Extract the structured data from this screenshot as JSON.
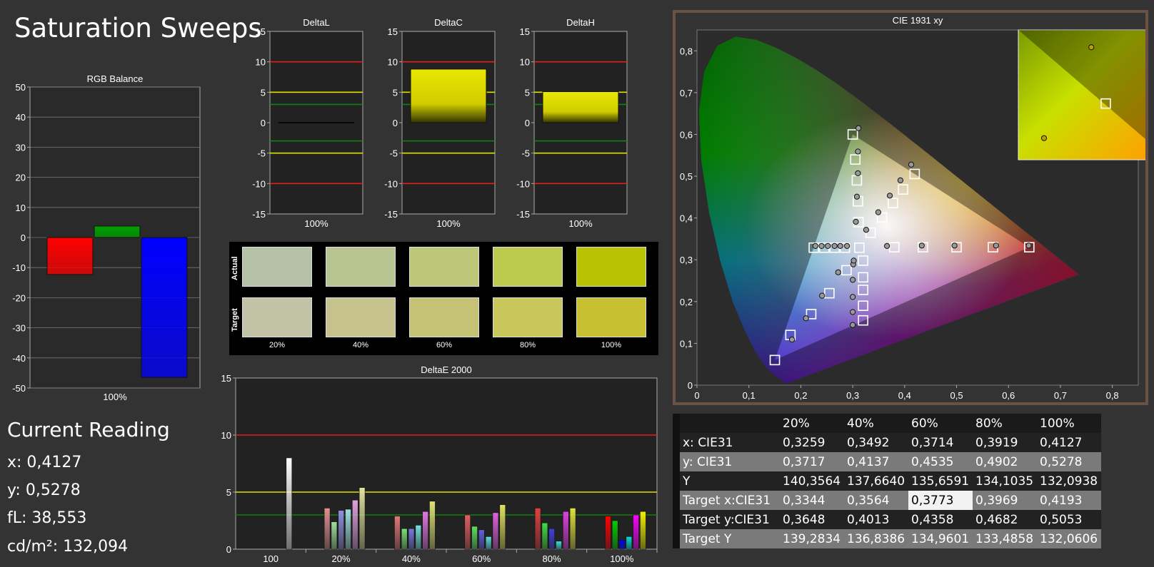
{
  "page_title": "Saturation Sweeps",
  "current_reading": {
    "title": "Current Reading",
    "x": "x: 0,4127",
    "y": "y: 0,5278",
    "fL": "fL: 38,553",
    "cdm2": "cd/m²: 132,094"
  },
  "swatches": {
    "row_labels": {
      "actual": "Actual",
      "target": "Target"
    },
    "labels": [
      "20%",
      "40%",
      "60%",
      "80%",
      "100%"
    ],
    "actual_colors": [
      "#b6c2a7",
      "#b9c590",
      "#bcc777",
      "#bccb4e",
      "#b9c304"
    ],
    "target_colors": [
      "#c2c2a6",
      "#c5c28e",
      "#c5c276",
      "#c7c75c",
      "#c6c030"
    ]
  },
  "table": {
    "headers": [
      "20%",
      "40%",
      "60%",
      "80%",
      "100%"
    ],
    "rows": [
      {
        "label": "x: CIE31",
        "values": [
          "0,3259",
          "0,3492",
          "0,3714",
          "0,3919",
          "0,4127"
        ]
      },
      {
        "label": "y: CIE31",
        "values": [
          "0,3717",
          "0,4137",
          "0,4535",
          "0,4902",
          "0,5278"
        ]
      },
      {
        "label": "Y",
        "values": [
          "140,3564",
          "137,6640",
          "135,6591",
          "134,1035",
          "132,0938"
        ]
      },
      {
        "label": "Target x:CIE31",
        "values": [
          "0,3344",
          "0,3564",
          "0,3773",
          "0,3969",
          "0,4193"
        ]
      },
      {
        "label": "Target y:CIE31",
        "values": [
          "0,3648",
          "0,4013",
          "0,4358",
          "0,4682",
          "0,5053"
        ]
      },
      {
        "label": "Target Y",
        "values": [
          "139,2834",
          "136,8386",
          "134,9601",
          "133,4858",
          "132,0606"
        ]
      }
    ]
  },
  "chart_data": [
    {
      "type": "bar",
      "title": "RGB Balance",
      "categories": [
        "100%"
      ],
      "series": [
        {
          "name": "Red",
          "color": "#ff0000",
          "values": [
            -12.3
          ]
        },
        {
          "name": "Green",
          "color": "#00a000",
          "values": [
            3.8
          ]
        },
        {
          "name": "Blue",
          "color": "#0000ff",
          "values": [
            -46.5
          ]
        }
      ],
      "ylim": [
        -50,
        50
      ],
      "yticks": [
        "50",
        "40",
        "30",
        "20",
        "10",
        "0",
        "-10",
        "-20",
        "-30",
        "-40",
        "-50"
      ]
    },
    {
      "type": "bar",
      "title": "DeltaL",
      "categories": [
        "100%"
      ],
      "values": [
        -0.1
      ],
      "ylim": [
        -15,
        15
      ],
      "yticks": [
        "15",
        "10",
        "5",
        "0",
        "-5",
        "-10",
        "-15"
      ]
    },
    {
      "type": "bar",
      "title": "DeltaC",
      "categories": [
        "100%"
      ],
      "values": [
        8.8
      ],
      "ylim": [
        -15,
        15
      ],
      "yticks": [
        "15",
        "10",
        "5",
        "0",
        "-5",
        "-10",
        "-15"
      ]
    },
    {
      "type": "bar",
      "title": "DeltaH",
      "categories": [
        "100%"
      ],
      "values": [
        5.1
      ],
      "ylim": [
        -15,
        15
      ],
      "yticks": [
        "15",
        "10",
        "5",
        "0",
        "-5",
        "-10",
        "-15"
      ]
    },
    {
      "type": "bar",
      "title": "DeltaE 2000",
      "categories": [
        "100",
        "20%",
        "40%",
        "60%",
        "80%",
        "100%"
      ],
      "ylim": [
        0,
        15
      ],
      "yticks": [
        "15",
        "10",
        "5",
        "0"
      ],
      "groups": [
        {
          "bars": [
            {
              "value": 8.0,
              "color": "#ffffff"
            }
          ]
        },
        {
          "bars": [
            {
              "value": 3.6,
              "color": "#e09090"
            },
            {
              "value": 2.4,
              "color": "#a0e0a0"
            },
            {
              "value": 3.4,
              "color": "#9090e0"
            },
            {
              "value": 3.5,
              "color": "#a0e0e0"
            },
            {
              "value": 4.3,
              "color": "#e0a0e0"
            },
            {
              "value": 5.4,
              "color": "#e0e0a0"
            }
          ]
        },
        {
          "bars": [
            {
              "value": 2.9,
              "color": "#e07878"
            },
            {
              "value": 1.8,
              "color": "#78e078"
            },
            {
              "value": 1.8,
              "color": "#7878e0"
            },
            {
              "value": 2.1,
              "color": "#78e0e0"
            },
            {
              "value": 3.3,
              "color": "#e078e0"
            },
            {
              "value": 4.2,
              "color": "#e0e078"
            }
          ]
        },
        {
          "bars": [
            {
              "value": 3.0,
              "color": "#e06060"
            },
            {
              "value": 2.0,
              "color": "#60e060"
            },
            {
              "value": 1.7,
              "color": "#6060e0"
            },
            {
              "value": 1.1,
              "color": "#60e0e0"
            },
            {
              "value": 3.2,
              "color": "#e060e0"
            },
            {
              "value": 3.9,
              "color": "#e0e060"
            }
          ]
        },
        {
          "bars": [
            {
              "value": 3.6,
              "color": "#e04040"
            },
            {
              "value": 2.3,
              "color": "#40e040"
            },
            {
              "value": 1.8,
              "color": "#4040e0"
            },
            {
              "value": 0.7,
              "color": "#40e0e0"
            },
            {
              "value": 3.3,
              "color": "#e040e0"
            },
            {
              "value": 3.6,
              "color": "#e0e040"
            }
          ]
        },
        {
          "bars": [
            {
              "value": 2.9,
              "color": "#ff0000"
            },
            {
              "value": 2.5,
              "color": "#00d000"
            },
            {
              "value": 0.8,
              "color": "#0000ff"
            },
            {
              "value": 1.1,
              "color": "#00e0e0"
            },
            {
              "value": 3.0,
              "color": "#ff00ff"
            },
            {
              "value": 3.3,
              "color": "#f0f000"
            }
          ]
        }
      ]
    },
    {
      "type": "scatter",
      "title": "CIE 1931 xy",
      "xlim": [
        0,
        0.85
      ],
      "ylim": [
        0,
        0.85
      ],
      "xticks": [
        "0",
        "0,1",
        "0,2",
        "0,3",
        "0,4",
        "0,5",
        "0,6",
        "0,7",
        "0,8"
      ],
      "yticks": [
        "0",
        "0,1",
        "0,2",
        "0,3",
        "0,4",
        "0,5",
        "0,6",
        "0,7",
        "0,8"
      ],
      "gamut_triangle": [
        [
          0.64,
          0.33
        ],
        [
          0.3,
          0.6
        ],
        [
          0.15,
          0.06
        ]
      ],
      "targets": [
        [
          0.64,
          0.33
        ],
        [
          0.57,
          0.33
        ],
        [
          0.5,
          0.33
        ],
        [
          0.435,
          0.33
        ],
        [
          0.38,
          0.33
        ],
        [
          0.3,
          0.6
        ],
        [
          0.305,
          0.54
        ],
        [
          0.308,
          0.49
        ],
        [
          0.31,
          0.44
        ],
        [
          0.311,
          0.39
        ],
        [
          0.15,
          0.06
        ],
        [
          0.18,
          0.12
        ],
        [
          0.22,
          0.17
        ],
        [
          0.255,
          0.22
        ],
        [
          0.288,
          0.275
        ],
        [
          0.225,
          0.329
        ],
        [
          0.245,
          0.329
        ],
        [
          0.265,
          0.329
        ],
        [
          0.285,
          0.329
        ],
        [
          0.32,
          0.155
        ],
        [
          0.32,
          0.19
        ],
        [
          0.32,
          0.228
        ],
        [
          0.32,
          0.258
        ],
        [
          0.32,
          0.298
        ],
        [
          0.4193,
          0.5053
        ],
        [
          0.3969,
          0.4682
        ],
        [
          0.3773,
          0.4358
        ],
        [
          0.3564,
          0.4013
        ],
        [
          0.3344,
          0.3648
        ],
        [
          0.3127,
          0.329
        ]
      ],
      "measured": [
        [
          0.639,
          0.334
        ],
        [
          0.576,
          0.334
        ],
        [
          0.496,
          0.334
        ],
        [
          0.433,
          0.334
        ],
        [
          0.366,
          0.333
        ],
        [
          0.311,
          0.615
        ],
        [
          0.31,
          0.559
        ],
        [
          0.31,
          0.507
        ],
        [
          0.308,
          0.451
        ],
        [
          0.306,
          0.391
        ],
        [
          0.183,
          0.109
        ],
        [
          0.21,
          0.16
        ],
        [
          0.241,
          0.214
        ],
        [
          0.272,
          0.27
        ],
        [
          0.228,
          0.333
        ],
        [
          0.24,
          0.333
        ],
        [
          0.252,
          0.333
        ],
        [
          0.265,
          0.333
        ],
        [
          0.276,
          0.333
        ],
        [
          0.289,
          0.333
        ],
        [
          0.3,
          0.144
        ],
        [
          0.3,
          0.175
        ],
        [
          0.3,
          0.211
        ],
        [
          0.3,
          0.252
        ],
        [
          0.301,
          0.289
        ],
        [
          0.302,
          0.298
        ],
        [
          0.4127,
          0.5278
        ],
        [
          0.3919,
          0.4902
        ],
        [
          0.3714,
          0.4535
        ],
        [
          0.3492,
          0.4137
        ],
        [
          0.3259,
          0.3717
        ]
      ],
      "inset": {
        "measured": [
          [
            0.692,
            0.81
          ],
          [
            0.6,
            0.6
          ]
        ],
        "targets": [
          [
            0.72,
            0.68
          ]
        ]
      }
    }
  ]
}
